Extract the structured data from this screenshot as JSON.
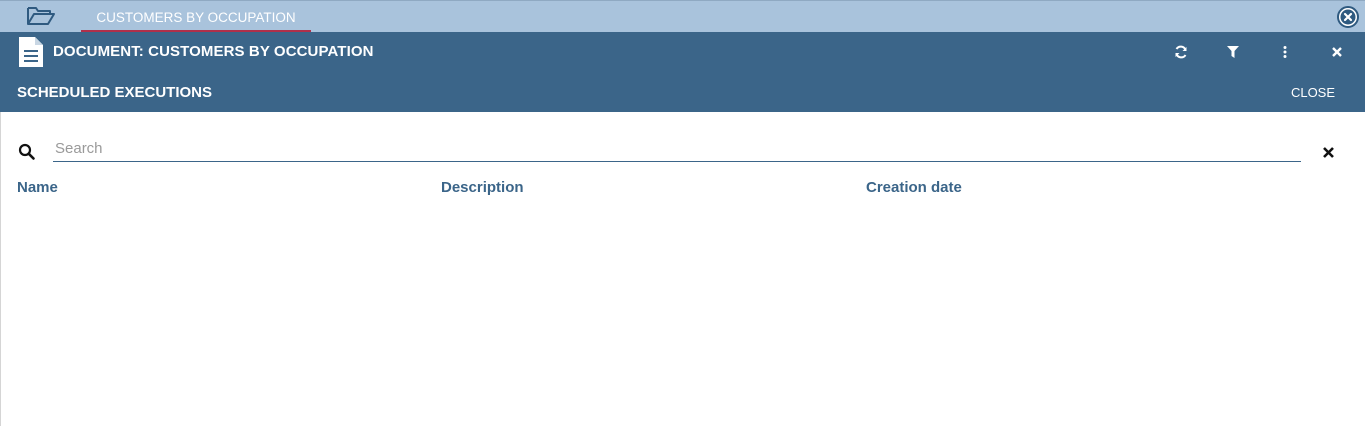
{
  "tabbar": {
    "tab_label": "CUSTOMERS BY OCCUPATION",
    "folder_icon": "folder-open-icon",
    "close_all_icon": "circle-close-icon"
  },
  "doc_toolbar": {
    "title": "DOCUMENT: CUSTOMERS BY OCCUPATION",
    "doc_icon": "document-icon",
    "actions": [
      "refresh-icon",
      "filter-icon",
      "more-vert-icon",
      "close-icon"
    ]
  },
  "scheduled": {
    "title": "SCHEDULED EXECUTIONS",
    "close_label": "CLOSE"
  },
  "search": {
    "placeholder": "Search",
    "value": ""
  },
  "table": {
    "columns": [
      "Name",
      "Description",
      "Creation date"
    ],
    "rows": []
  },
  "colors": {
    "tabbar_bg": "#a9c3dc",
    "toolbar_bg": "#3b6589",
    "tab_accent": "#b0304a",
    "header_text": "#3b6589"
  }
}
